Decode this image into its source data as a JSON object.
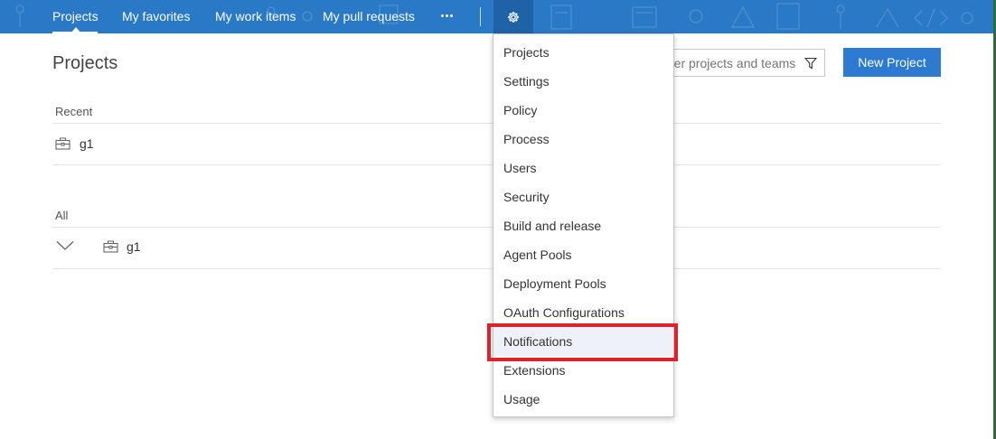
{
  "nav": {
    "items": [
      {
        "label": "Projects"
      },
      {
        "label": "My favorites"
      },
      {
        "label": "My work items"
      },
      {
        "label": "My pull requests"
      }
    ],
    "more_icon": "ellipsis-icon",
    "settings_icon": "gear-icon"
  },
  "page": {
    "title": "Projects",
    "filter_placeholder": "Filter projects and teams",
    "filter_value": "",
    "new_project_label": "New Project"
  },
  "recent": {
    "label": "Recent",
    "projects": [
      {
        "name": "g1"
      }
    ]
  },
  "all": {
    "label": "All",
    "projects": [
      {
        "name": "g1"
      }
    ]
  },
  "settings_menu": {
    "items": [
      {
        "label": "Projects"
      },
      {
        "label": "Settings"
      },
      {
        "label": "Policy"
      },
      {
        "label": "Process"
      },
      {
        "label": "Users"
      },
      {
        "label": "Security"
      },
      {
        "label": "Build and release"
      },
      {
        "label": "Agent Pools"
      },
      {
        "label": "Deployment Pools"
      },
      {
        "label": "OAuth Configurations"
      },
      {
        "label": "Notifications"
      },
      {
        "label": "Extensions"
      },
      {
        "label": "Usage"
      }
    ],
    "highlighted": "Notifications"
  },
  "colors": {
    "nav_bg": "#2979c7",
    "accent": "#2c7bd0",
    "highlight_border": "#e0202a"
  }
}
